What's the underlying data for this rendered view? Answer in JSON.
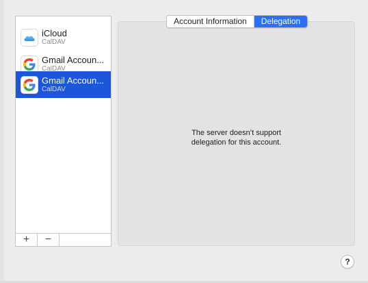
{
  "accounts": [
    {
      "name": "iCloud",
      "type": "CalDAV",
      "icon": "icloud-icon"
    },
    {
      "name": "Gmail Accoun...",
      "type": "CalDAV",
      "icon": "google-g-icon"
    },
    {
      "name": "Gmail Accoun...",
      "type": "CalDAV",
      "icon": "google-g-icon",
      "selected": true
    }
  ],
  "list_footer": {
    "add_label": "+",
    "remove_label": "−"
  },
  "tabs": [
    {
      "label": "Account Information",
      "active": false
    },
    {
      "label": "Delegation",
      "active": true
    }
  ],
  "message": {
    "line1": "The server doesn’t support",
    "line2": "delegation for this account."
  },
  "help": {
    "label": "?"
  },
  "colors": {
    "selection": "#1d57d9",
    "active_tab": "#2d6ff2",
    "panel": "#e3e3e3"
  }
}
